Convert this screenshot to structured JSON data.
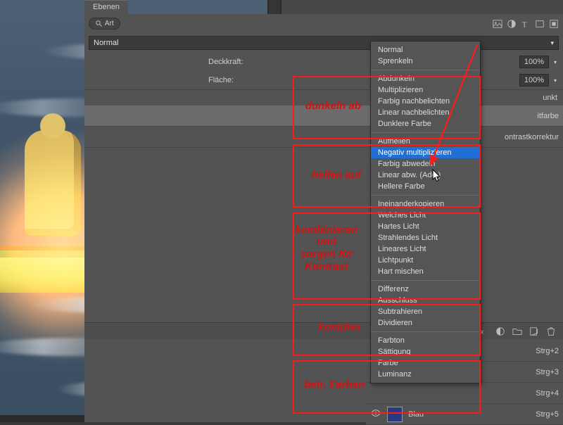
{
  "panel": {
    "tab": "Ebenen"
  },
  "search": {
    "label": "Art"
  },
  "blend_selected": "Normal",
  "props": {
    "opacity_label": "Deckkraft:",
    "opacity_value": "100%",
    "fill_label": "Fläche:",
    "fill_value": "100%",
    "lock_label": "unkt"
  },
  "icons": {
    "image": "image-filter-icon",
    "adjust": "adjust-filter-icon",
    "type": "type-filter-icon",
    "shape": "shape-filter-icon",
    "smart": "smart-filter-icon"
  },
  "layers": [
    {
      "name": "itfarbe",
      "selected": true,
      "shortcut": ""
    },
    {
      "name": "ontrastkorrektur",
      "selected": false,
      "shortcut": ""
    }
  ],
  "hidden_layers": [
    {
      "name": "",
      "shortcut": "Strg+2"
    },
    {
      "name": "",
      "shortcut": "Strg+3"
    },
    {
      "name": "",
      "shortcut": "Strg+4"
    },
    {
      "name": "Blau",
      "shortcut": "Strg+5"
    }
  ],
  "blend_modes": {
    "group_top": [
      "Normal",
      "Sprenkeln"
    ],
    "group_darken": [
      "Abdunkeln",
      "Multiplizieren",
      "Farbig nachbelichten",
      "Linear nachbelichten",
      "Dunklere Farbe"
    ],
    "group_lighten": [
      "Aufhellen",
      "Negativ multiplizieren",
      "Farbig abwedeln",
      "Linear abw. (Add.)",
      "Hellere Farbe"
    ],
    "group_contrast": [
      "Ineinanderkopieren",
      "Weiches Licht",
      "Hartes Licht",
      "Strahlendes Licht",
      "Lineares Licht",
      "Lichtpunkt",
      "Hart mischen"
    ],
    "group_complex": [
      "Differenz",
      "Ausschluss",
      "Subtrahieren",
      "Dividieren"
    ],
    "group_color": [
      "Farbton",
      "Sättigung",
      "Farbe",
      "Luminanz"
    ]
  },
  "blend_highlight": "Negativ multiplizieren",
  "annotations": {
    "darken": "dunkeln ab",
    "lighten": "hellen auf",
    "contrast": "kombinieren\nund\nsorgen für\nKontrast",
    "complex": "komplex",
    "color": "betr. Farben"
  }
}
